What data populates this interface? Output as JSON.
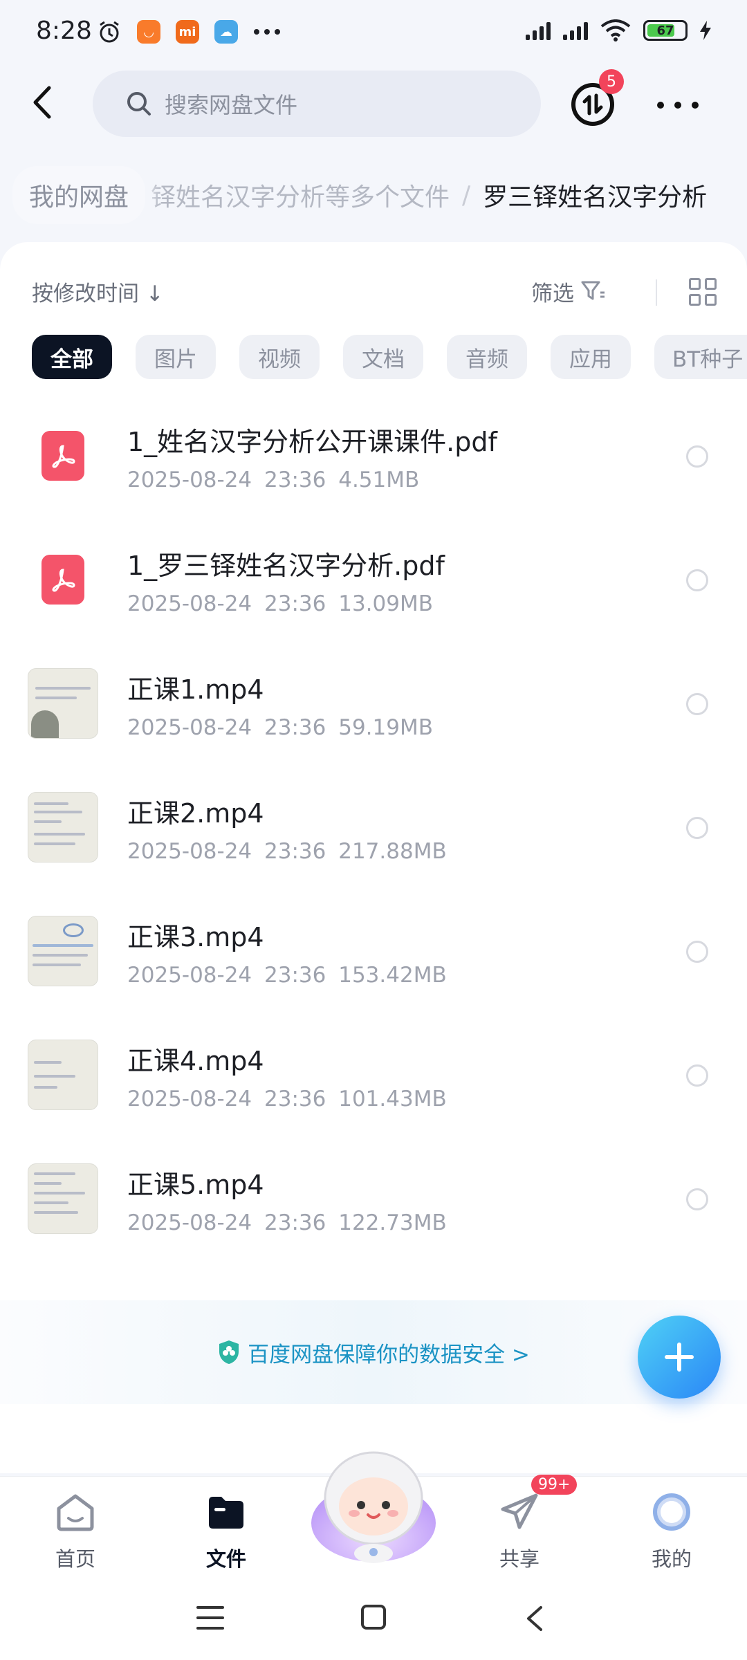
{
  "status_bar": {
    "time": "8:28",
    "battery_level": "67",
    "left_icons": [
      "alarm-icon",
      "taobao-icon",
      "mi-icon",
      "weather-icon",
      "more-dots-icon"
    ],
    "right_icons": [
      "signal-icon",
      "hd-signal-icon",
      "wifi-icon",
      "battery-icon",
      "charging-icon"
    ]
  },
  "topbar": {
    "search_placeholder": "搜索网盘文件",
    "transfer_badge": "5"
  },
  "breadcrumb": {
    "root": "我的网盘",
    "middle": "铎姓名汉字分析等多个文件",
    "separator": "/",
    "current": "罗三铎姓名汉字分析"
  },
  "toolbar": {
    "sort_label": "按修改时间 ↓",
    "filter_label": "筛选"
  },
  "chips": [
    {
      "label": "全部",
      "active": true
    },
    {
      "label": "图片",
      "active": false
    },
    {
      "label": "视频",
      "active": false
    },
    {
      "label": "文档",
      "active": false
    },
    {
      "label": "音频",
      "active": false
    },
    {
      "label": "应用",
      "active": false
    },
    {
      "label": "BT种子",
      "active": false
    }
  ],
  "files": [
    {
      "name": "1_姓名汉字分析公开课课件.pdf",
      "date": "2025-08-24",
      "time": "23:36",
      "size": "4.51MB",
      "type": "pdf"
    },
    {
      "name": "1_罗三铎姓名汉字分析.pdf",
      "date": "2025-08-24",
      "time": "23:36",
      "size": "13.09MB",
      "type": "pdf"
    },
    {
      "name": "正课1.mp4",
      "date": "2025-08-24",
      "time": "23:36",
      "size": "59.19MB",
      "type": "video"
    },
    {
      "name": "正课2.mp4",
      "date": "2025-08-24",
      "time": "23:36",
      "size": "217.88MB",
      "type": "video"
    },
    {
      "name": "正课3.mp4",
      "date": "2025-08-24",
      "time": "23:36",
      "size": "153.42MB",
      "type": "video"
    },
    {
      "name": "正课4.mp4",
      "date": "2025-08-24",
      "time": "23:36",
      "size": "101.43MB",
      "type": "video"
    },
    {
      "name": "正课5.mp4",
      "date": "2025-08-24",
      "time": "23:36",
      "size": "122.73MB",
      "type": "video"
    }
  ],
  "safety_banner": "百度网盘保障你的数据安全 >",
  "bottom_nav": {
    "home": "首页",
    "files": "文件",
    "share": "共享",
    "share_badge": "99+",
    "mine": "我的"
  },
  "colors": {
    "accent": "#2a86f7",
    "active_chip": "#0c1424",
    "badge": "#f2445b",
    "pdf": "#f4546a"
  }
}
